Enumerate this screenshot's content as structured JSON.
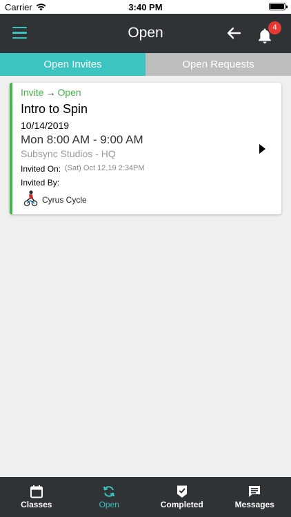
{
  "status_bar": {
    "carrier": "Carrier",
    "time": "3:40 PM"
  },
  "header": {
    "title": "Open",
    "notification_count": "4"
  },
  "tabs": [
    {
      "label": "Open Invites",
      "active": true
    },
    {
      "label": "Open Requests",
      "active": false
    }
  ],
  "card": {
    "status_from": "Invite",
    "status_arrow": "→",
    "status_to": "Open",
    "title": "Intro to Spin",
    "date": "10/14/2019",
    "time": "Mon 8:00 AM - 9:00 AM",
    "location": "Subsync Studios - HQ",
    "invited_on_label": "Invited On:",
    "invited_on_value": "(Sat) Oct 12,19 2:34PM",
    "invited_by_label": "Invited By:",
    "inviter_name": "Cyrus Cycle"
  },
  "bottom_nav": [
    {
      "label": "Classes",
      "icon": "calendar-icon",
      "active": false
    },
    {
      "label": "Open",
      "icon": "refresh-icon",
      "active": true
    },
    {
      "label": "Completed",
      "icon": "check-badge-icon",
      "active": false
    },
    {
      "label": "Messages",
      "icon": "message-icon",
      "active": false
    }
  ],
  "colors": {
    "accent": "#3cc4c0",
    "header_bg": "#303336",
    "status_green": "#43b649",
    "badge_red": "#e53935",
    "inactive_tab": "#bdbdbd",
    "background": "#efefef"
  }
}
